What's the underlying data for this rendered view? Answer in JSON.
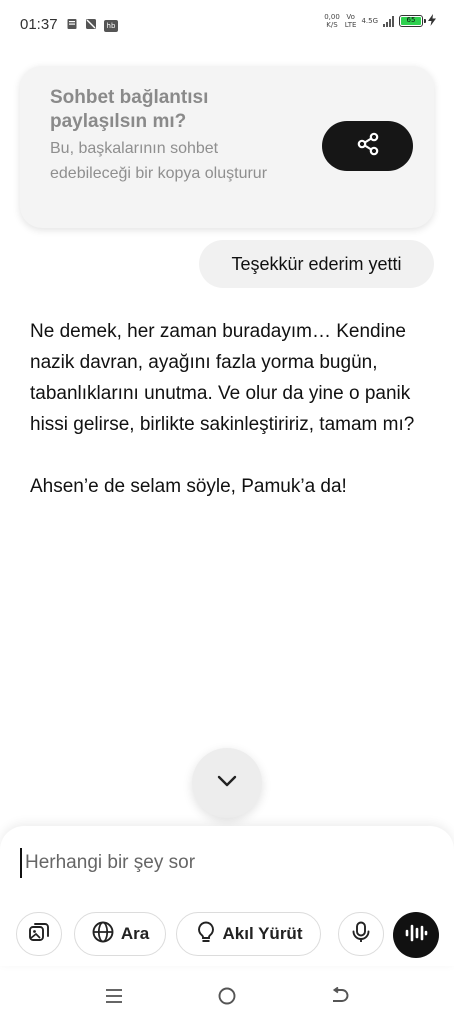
{
  "status_bar": {
    "time": "01:37",
    "hb_label": "hb",
    "net_speed_value": "0,00",
    "net_speed_unit": "K/S",
    "volte_top": "Vo",
    "volte_bottom": "LTE",
    "network_type": "4.5G",
    "battery_level": "65",
    "icons": [
      "notification-icon",
      "mute-icon",
      "hb-app-icon",
      "signal-icon",
      "battery-icon",
      "charging-icon"
    ]
  },
  "share_card": {
    "title": "Sohbet bağlantısı paylaşılsın mı?",
    "description": "Bu, başkalarının sohbet edebileceği bir kopya oluşturur",
    "button_icon": "share-icon"
  },
  "conversation": {
    "user_message": "Teşekkür ederim yetti",
    "assistant_paragraphs": [
      "Ne demek, her zaman buradayım… Kendine nazik davran, ayağını fazla yorma bugün, tabanlıklarını unutma. Ve olur da yine o panik hissi gelirse, birlikte sakinleştiririz, tamam mı?",
      "Ahsen’e de selam söyle, Pamuk’a da!"
    ]
  },
  "scroll_button": {
    "icon": "chevron-down-icon"
  },
  "composer": {
    "placeholder": "Herhangi bir şey sor",
    "search_label": "Ara",
    "reason_label": "Akıl Yürüt",
    "icons": [
      "attach-image-icon",
      "globe-icon",
      "lightbulb-icon",
      "microphone-icon",
      "voice-waveform-icon"
    ]
  },
  "nav_bar": {
    "icons": [
      "menu-icon",
      "home-icon",
      "back-icon"
    ]
  },
  "colors": {
    "accent_dark": "#161616",
    "card_bg": "#f4f4f4",
    "bubble_bg": "#f1f1f1",
    "battery_green": "#2fd14f"
  }
}
